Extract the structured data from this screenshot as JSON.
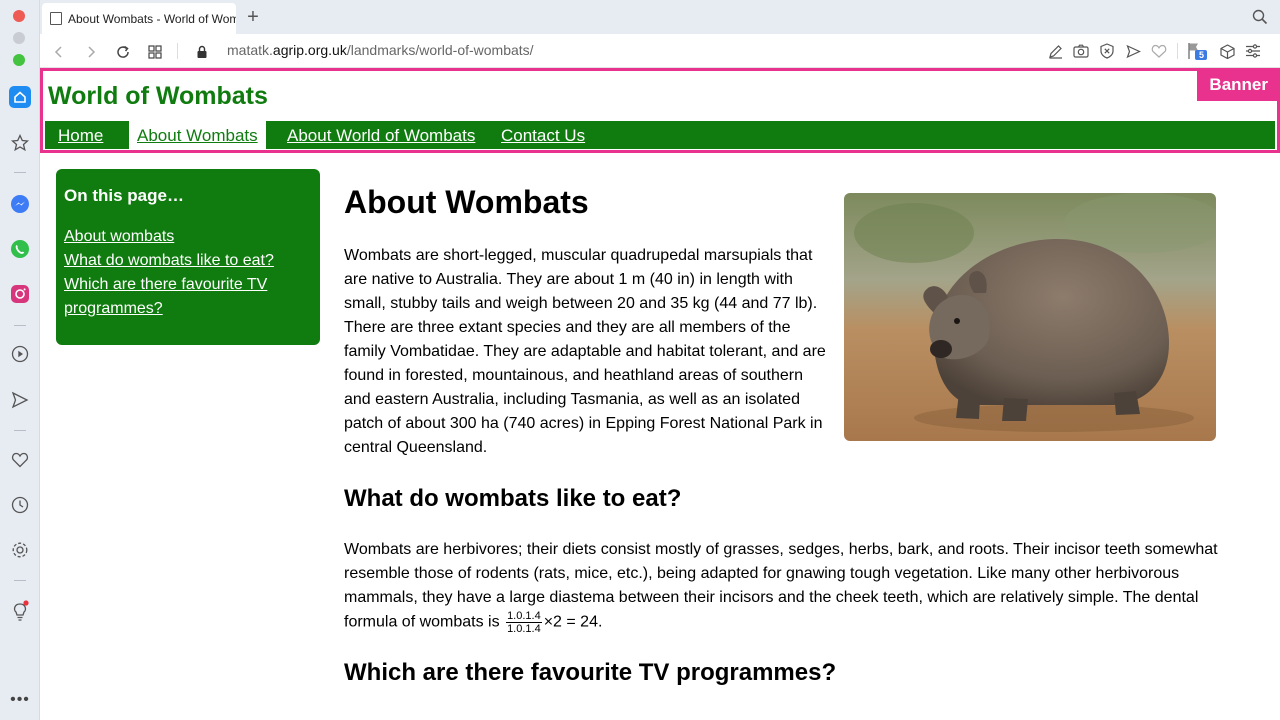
{
  "browser": {
    "tab_title": "About Wombats - World of Wombats",
    "new_tab_symbol": "+",
    "url_prefix": "matatk.",
    "url_host": "agrip.org.uk",
    "url_path": "/landmarks/world-of-wombats/",
    "flag_badge_count": "5"
  },
  "banner": {
    "site_title": "World of Wombats",
    "landmark_tag": "Banner",
    "nav": [
      {
        "label": "Home"
      },
      {
        "label": "About Wombats",
        "active": true
      },
      {
        "label": "About World of Wombats"
      },
      {
        "label": "Contact Us"
      }
    ]
  },
  "toc": {
    "heading": "On this page…",
    "links": [
      "About wombats",
      "What do wombats like to eat?",
      "Which are there favourite TV programmes?"
    ]
  },
  "main": {
    "title": "About Wombats",
    "intro": "Wombats are short-legged, muscular quadrupedal marsupials that are native to Australia. They are about 1 m (40 in) in length with small, stubby tails and weigh between 20 and 35 kg (44 and 77 lb). There are three extant species and they are all members of the family Vombatidae. They are adaptable and habitat tolerant, and are found in forested, mountainous, and heathland areas of southern and eastern Australia, including Tasmania, as well as an isolated patch of about 300 ha (740 acres) in Epping Forest National Park in central Queensland.",
    "eat_heading": "What do wombats like to eat?",
    "eat_text": "Wombats are herbivores; their diets consist mostly of grasses, sedges, herbs, bark, and roots. Their incisor teeth somewhat resemble those of rodents (rats, mice, etc.), being adapted for gnawing tough vegetation. Like many other herbivorous mammals, they have a large diastema between their incisors and the cheek teeth, which are relatively simple. The dental formula of wombats is",
    "formula_numerator": "1.0.1.4",
    "formula_denominator": "1.0.1.4",
    "formula_tail": "×2 = 24.",
    "tv_heading": "Which are there favourite TV programmes?"
  }
}
